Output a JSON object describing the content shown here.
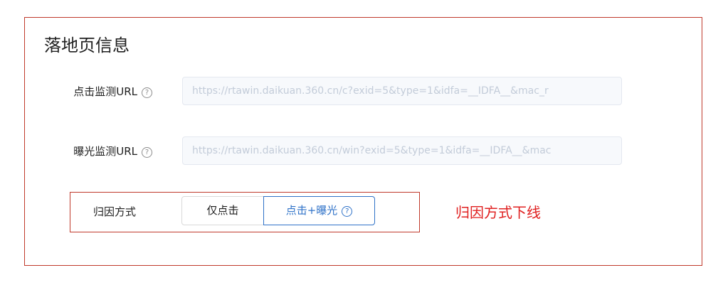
{
  "section": {
    "title": "落地页信息"
  },
  "click_url": {
    "label": "点击监测URL",
    "help_icon": "question-circle-icon",
    "value": "https://rtawin.daikuan.360.cn/c?exid=5&type=1&idfa=__IDFA__&mac_r"
  },
  "impression_url": {
    "label": "曝光监测URL",
    "help_icon": "question-circle-icon",
    "value": "https://rtawin.daikuan.360.cn/win?exid=5&type=1&idfa=__IDFA__&mac"
  },
  "attribution": {
    "label": "归因方式",
    "options": [
      {
        "label": "仅点击",
        "selected": false
      },
      {
        "label": "点击+曝光",
        "selected": true,
        "help_icon": "question-circle-icon"
      }
    ]
  },
  "annotation": {
    "text": "归因方式下线",
    "color": "#e02020"
  },
  "colors": {
    "accent": "#2f72c8",
    "annotation_border": "#c0392b"
  }
}
